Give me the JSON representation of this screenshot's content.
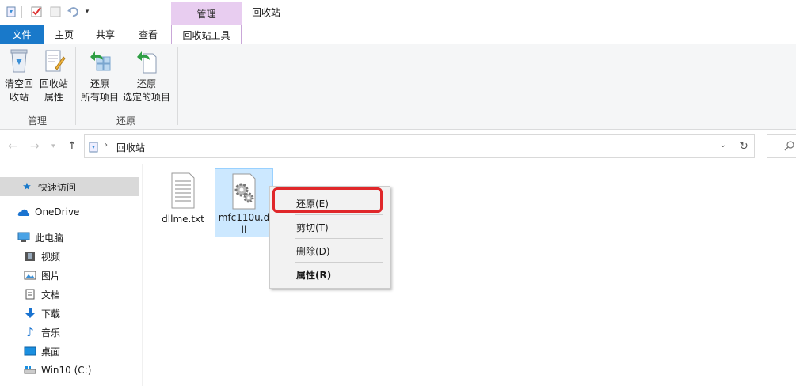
{
  "window": {
    "title": "回收站",
    "context_tab_group": "管理"
  },
  "tabs": {
    "file": "文件",
    "home": "主页",
    "share": "共享",
    "view": "查看",
    "recycle_tools": "回收站工具"
  },
  "ribbon": {
    "empty_bin": "清空回\n收站",
    "bin_properties": "回收站\n属性",
    "restore_all": "还原\n所有项目",
    "restore_selected": "还原\n选定的项目",
    "group_manage": "管理",
    "group_restore": "还原"
  },
  "address": {
    "path": "回收站"
  },
  "nav": {
    "quick_access": "快速访问",
    "onedrive": "OneDrive",
    "this_pc": "此电脑",
    "videos": "视频",
    "pictures": "图片",
    "documents": "文档",
    "downloads": "下载",
    "music": "音乐",
    "desktop": "桌面",
    "drive_c": "Win10 (C:)"
  },
  "files": [
    {
      "name": "dllme.txt",
      "type": "text"
    },
    {
      "name": "mfc110u.dll",
      "type": "dll",
      "selected": true
    }
  ],
  "context_menu": {
    "restore": "还原(E)",
    "cut": "剪切(T)",
    "delete": "删除(D)",
    "properties": "属性(R)"
  },
  "colors": {
    "accent": "#1979ca",
    "context_tab": "#e8cdf0",
    "selection": "#cce8ff",
    "highlight_ring": "#e0272a"
  }
}
